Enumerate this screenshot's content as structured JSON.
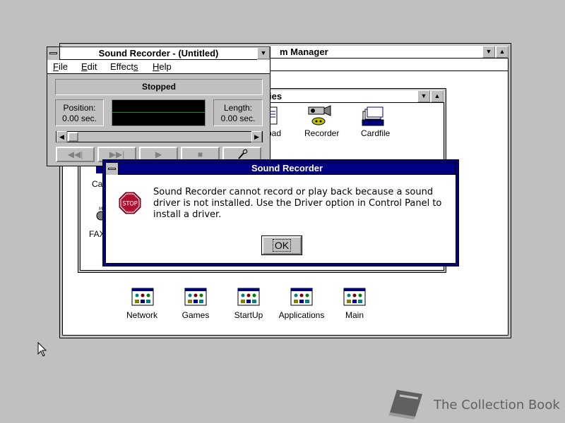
{
  "program_manager": {
    "title_fragment": "m Manager",
    "group_icons": [
      {
        "label": "Network"
      },
      {
        "label": "Games"
      },
      {
        "label": "StartUp"
      },
      {
        "label": "Applications"
      },
      {
        "label": "Main"
      }
    ]
  },
  "accessories_group": {
    "title_fragment": "ies",
    "icons": [
      {
        "label": "pad",
        "icon": "notepad-icon"
      },
      {
        "label": "Recorder",
        "icon": "sound-recorder-icon"
      },
      {
        "label": "Cardfile",
        "icon": "cardfile-icon"
      },
      {
        "label": "Ca",
        "icon": "calendar-icon"
      },
      {
        "label": "FAX",
        "icon": "fax-icon"
      }
    ]
  },
  "sound_recorder": {
    "title": "Sound Recorder - (Untitled)",
    "menu": [
      {
        "label": "File",
        "mnemonic": "F",
        "rest": "ile"
      },
      {
        "label": "Edit",
        "mnemonic": "E",
        "rest": "dit"
      },
      {
        "label": "Effects",
        "pre": "Effect",
        "mnemonic": "s",
        "rest": ""
      },
      {
        "label": "Help",
        "mnemonic": "H",
        "rest": "elp"
      }
    ],
    "status": "Stopped",
    "position_label": "Position:",
    "position_value": "0.00 sec.",
    "length_label": "Length:",
    "length_value": "0.00 sec.",
    "buttons": [
      "rewind",
      "fast-forward",
      "play",
      "stop",
      "record"
    ]
  },
  "dialog": {
    "title": "Sound Recorder",
    "stop_sign_text": "STOP",
    "message": "Sound Recorder cannot record or play back because a sound driver is not installed. Use the Driver option in Control Panel to install a driver.",
    "ok_label": "OK"
  },
  "watermark": {
    "text": "The Collection Book"
  },
  "colors": {
    "desktop": "#c0c0c0",
    "active_title": "#000080",
    "waveform_line": "#00a000",
    "stop_red": "#b01030"
  }
}
